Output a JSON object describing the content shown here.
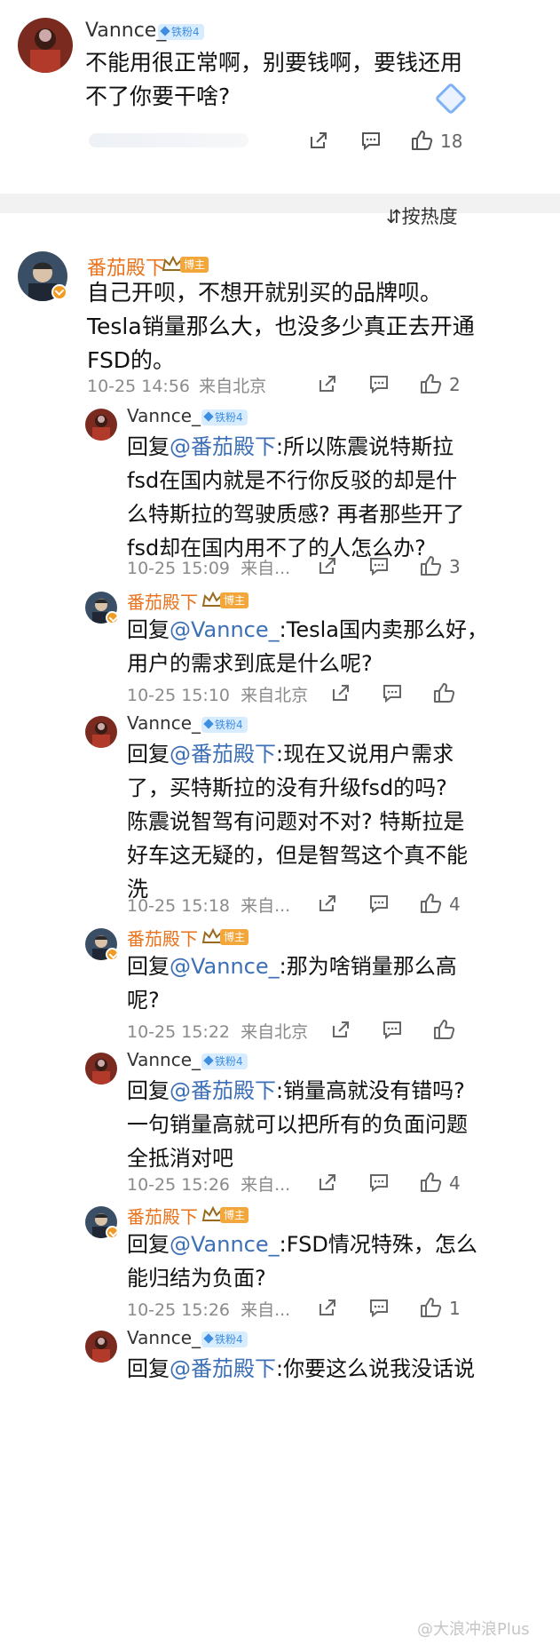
{
  "original": {
    "username": "Vannce_",
    "fan_badge": "铁粉4",
    "text": "不能用很正常啊，别要钱啊，要钱还用\n不了你要干啥?",
    "like_count": "18"
  },
  "sort_label": "按热度",
  "comments": [
    {
      "username": "番茄殿下",
      "role_tag": "博主",
      "text": "自己开呗，不想开就别买的品牌呗。\nTesla销量那么大，也没多少真正去开通\nFSD的。",
      "time": "10-25 14:56",
      "location": "来自北京",
      "likes": "2"
    }
  ],
  "replies": [
    {
      "username": "Vannce_",
      "badge": "铁粉4",
      "reply_prefix": "回复",
      "mention": "@番茄殿下",
      "text": ":所以陈震说特斯拉\nfsd在国内就是不行你反驳的却是什\n么特斯拉的驾驶质感? 再者那些开了\nfsd却在国内用不了的人怎么办?",
      "meta": "10-25 15:09  来自...",
      "likes": "3"
    },
    {
      "username": "番茄殿下",
      "badge": "博主",
      "reply_prefix": "回复",
      "mention": "@Vannce_",
      "text": ":Tesla国内卖那么好，\n用户的需求到底是什么呢?",
      "meta": "10-25 15:10  来自北京",
      "likes": ""
    },
    {
      "username": "Vannce_",
      "badge": "铁粉4",
      "reply_prefix": "回复",
      "mention": "@番茄殿下",
      "text": ":现在又说用户需求\n了，买特斯拉的没有升级fsd的吗?\n陈震说智驾有问题对不对? 特斯拉是\n好车这无疑的，但是智驾这个真不能\n洗",
      "meta": "10-25 15:18  来自...",
      "likes": "4"
    },
    {
      "username": "番茄殿下",
      "badge": "博主",
      "reply_prefix": "回复",
      "mention": "@Vannce_",
      "text": ":那为啥销量那么高\n呢?",
      "meta": "10-25 15:22  来自北京",
      "likes": ""
    },
    {
      "username": "Vannce_",
      "badge": "铁粉4",
      "reply_prefix": "回复",
      "mention": "@番茄殿下",
      "text": ":销量高就没有错吗?\n一句销量高就可以把所有的负面问题\n全抵消对吧",
      "meta": "10-25 15:26  来自...",
      "likes": "4"
    },
    {
      "username": "番茄殿下",
      "badge": "博主",
      "reply_prefix": "回复",
      "mention": "@Vannce_",
      "text": ":FSD情况特殊，怎么\n能归结为负面?",
      "meta": "10-25 15:26  来自...",
      "likes": "1"
    },
    {
      "username": "Vannce_",
      "badge": "铁粉4",
      "reply_prefix": "回复",
      "mention": "@番茄殿下",
      "text": ":你要这么说我没话说",
      "meta": "",
      "likes": ""
    }
  ],
  "watermark": "@大浪冲浪Plus",
  "colors": {
    "name_orange": "#e8731c",
    "mention_blue": "#3c6fb6",
    "fan_badge_bg": "#d8ecff",
    "blogger_tag": "#f3a63a"
  },
  "icons": [
    "share-icon",
    "comment-icon",
    "like-icon",
    "crown-icon",
    "sort-icon",
    "diamond-icon"
  ]
}
